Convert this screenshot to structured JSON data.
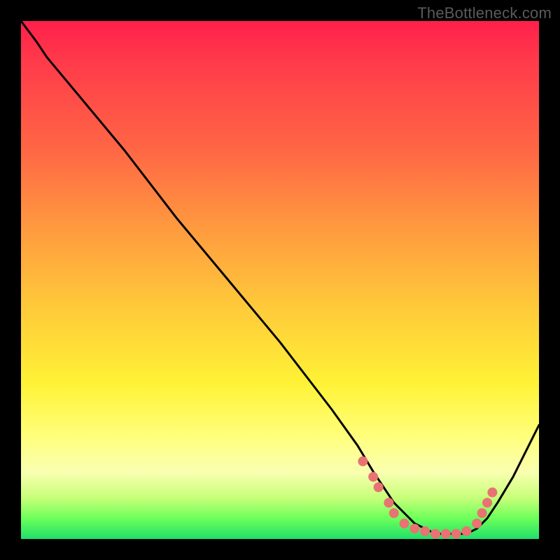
{
  "watermark": "TheBottleneck.com",
  "chart_data": {
    "type": "line",
    "title": "",
    "xlabel": "",
    "ylabel": "",
    "xlim": [
      0,
      100
    ],
    "ylim": [
      0,
      100
    ],
    "grid": false,
    "legend": false,
    "series": [
      {
        "name": "bottleneck-curve",
        "x": [
          0,
          3,
          5,
          10,
          20,
          30,
          40,
          50,
          60,
          65,
          68,
          70,
          72,
          74,
          76,
          78,
          80,
          82,
          84,
          86,
          88,
          90,
          92,
          95,
          100
        ],
        "y": [
          100,
          96,
          93,
          87,
          75,
          62,
          50,
          38,
          25,
          18,
          13,
          10,
          7,
          5,
          3,
          2,
          1,
          1,
          1,
          1,
          2,
          4,
          7,
          12,
          22
        ]
      }
    ],
    "markers": [
      {
        "x": 66,
        "y": 15
      },
      {
        "x": 68,
        "y": 12
      },
      {
        "x": 69,
        "y": 10
      },
      {
        "x": 71,
        "y": 7
      },
      {
        "x": 72,
        "y": 5
      },
      {
        "x": 74,
        "y": 3
      },
      {
        "x": 76,
        "y": 2
      },
      {
        "x": 78,
        "y": 1.5
      },
      {
        "x": 80,
        "y": 1
      },
      {
        "x": 82,
        "y": 1
      },
      {
        "x": 84,
        "y": 1
      },
      {
        "x": 86,
        "y": 1.5
      },
      {
        "x": 88,
        "y": 3
      },
      {
        "x": 89,
        "y": 5
      },
      {
        "x": 90,
        "y": 7
      },
      {
        "x": 91,
        "y": 9
      }
    ],
    "marker_color": "#e97272",
    "line_color": "#000000"
  }
}
